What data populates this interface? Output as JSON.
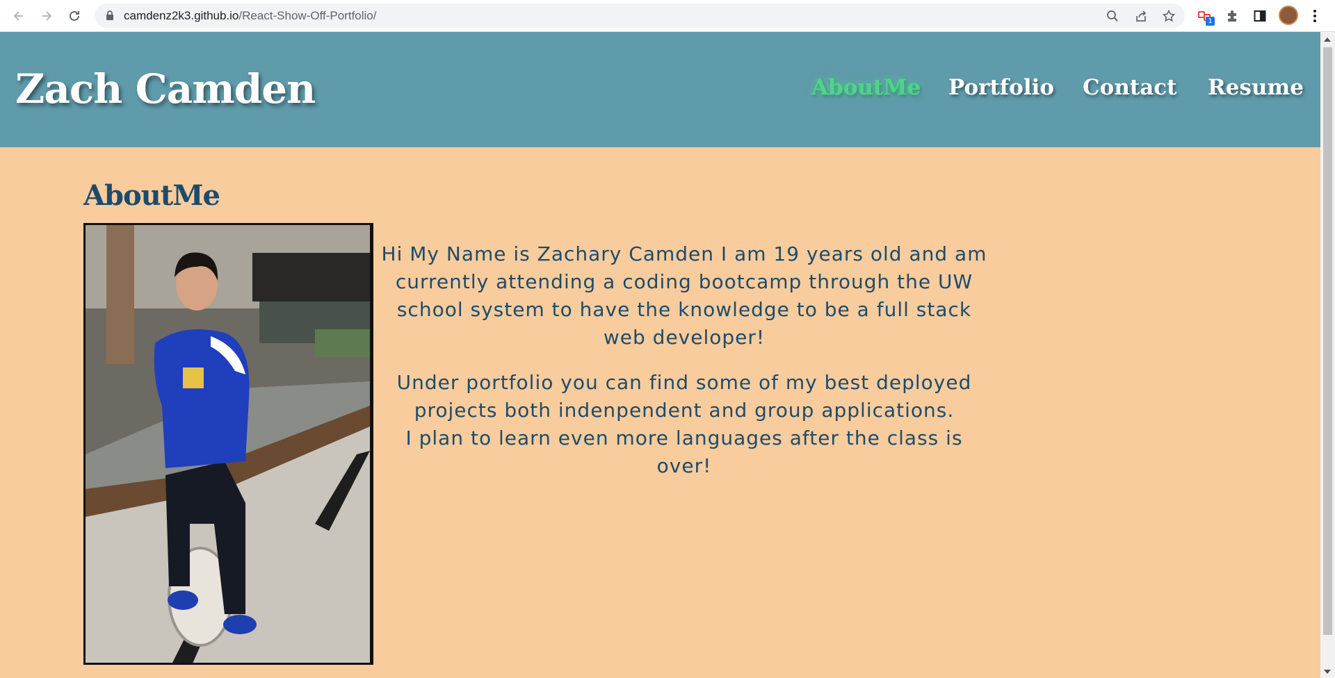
{
  "browser": {
    "url_host": "camdenz2k3.github.io",
    "url_path": "/React-Show-Off-Portfolio/",
    "extension_badge": "1",
    "icons": [
      "back-arrow-icon",
      "forward-arrow-icon",
      "reload-icon",
      "lock-icon",
      "zoom-icon",
      "share-icon",
      "star-icon",
      "extension-icon",
      "puzzle-icon",
      "side-panel-icon",
      "profile-avatar",
      "kebab-menu-icon"
    ]
  },
  "header": {
    "title": "Zach Camden",
    "nav": [
      {
        "label": "AboutMe",
        "active": true
      },
      {
        "label": "Portfolio",
        "active": false
      },
      {
        "label": "Contact",
        "active": false
      },
      {
        "label": "Resume",
        "active": false
      }
    ]
  },
  "about": {
    "heading": "AboutMe",
    "paragraph1": "Hi My Name is Zachary Camden I am 19 years old and am currently attending a coding bootcamp through the UW school system to have the knowledge to be a full stack web developer!",
    "paragraph2_line1": "Under portfolio you can find some of my best deployed projects both indenpendent and group applications.",
    "paragraph2_line2": "I plan to learn even more languages after the class is over!"
  },
  "colors": {
    "header_bg": "#5f9bab",
    "page_bg": "#f9cc9d",
    "heading_text": "#1d4b6a",
    "nav_active": "#4fd48a",
    "nav_text": "#ffffff"
  }
}
